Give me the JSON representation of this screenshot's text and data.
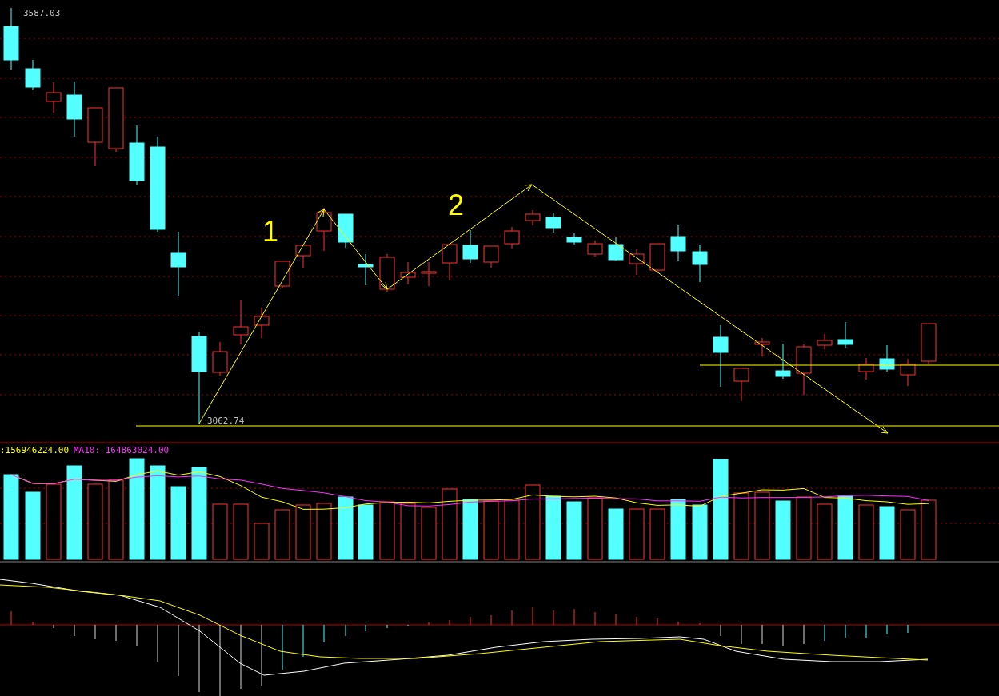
{
  "price_panel": {
    "high_label": "3587.03",
    "low_label": "3062.74",
    "wave_labels": [
      "1",
      "2"
    ]
  },
  "volume_panel": {
    "volume_label": ":156946224.00",
    "ma10_label": "MA10: 164863024.00"
  }
}
